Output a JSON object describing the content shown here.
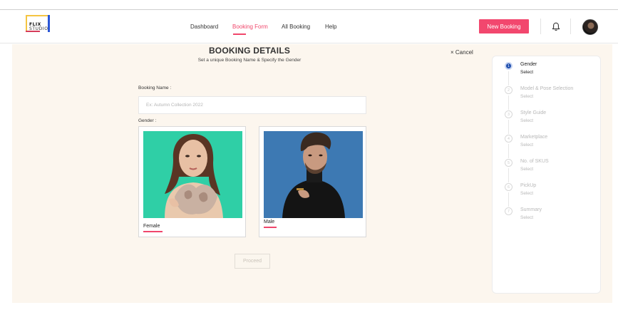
{
  "header": {
    "logo": {
      "line1": "FLIX",
      "line2": "STUDIO"
    },
    "nav": [
      "Dashboard",
      "Booking Form",
      "All Booking",
      "Help"
    ],
    "active_nav": "Booking Form",
    "new_booking_label": "New Booking",
    "icons": {
      "bell": "bell-icon",
      "avatar": "user-avatar"
    },
    "accent_color": "#f2476e"
  },
  "form": {
    "title": "BOOKING DETAILS",
    "subtitle": "Set a unique Booking Name & Specify the Gender",
    "cancel_label": "× Cancel",
    "booking_name_label": "Booking Name :",
    "booking_name_placeholder": "Ex: Autumn Collection 2022",
    "booking_name_value": "",
    "gender_label": "Gender :",
    "gender_options": [
      "Female",
      "Male"
    ],
    "proceed_label": "Proceed"
  },
  "stepper": {
    "steps": [
      {
        "num": "1",
        "name": "Gender",
        "sub": "Select",
        "active": true
      },
      {
        "num": "2",
        "name": "Model & Pose Selection",
        "sub": "Select",
        "active": false
      },
      {
        "num": "3",
        "name": "Style Guide",
        "sub": "Select",
        "active": false
      },
      {
        "num": "4",
        "name": "Marketplace",
        "sub": "Select",
        "active": false
      },
      {
        "num": "5",
        "name": "No. of SKUS",
        "sub": "Select",
        "active": false
      },
      {
        "num": "6",
        "name": "PickUp",
        "sub": "Select",
        "active": false
      },
      {
        "num": "7",
        "name": "Summary",
        "sub": "Select",
        "active": false
      }
    ],
    "active_color": "#1f4fae"
  }
}
